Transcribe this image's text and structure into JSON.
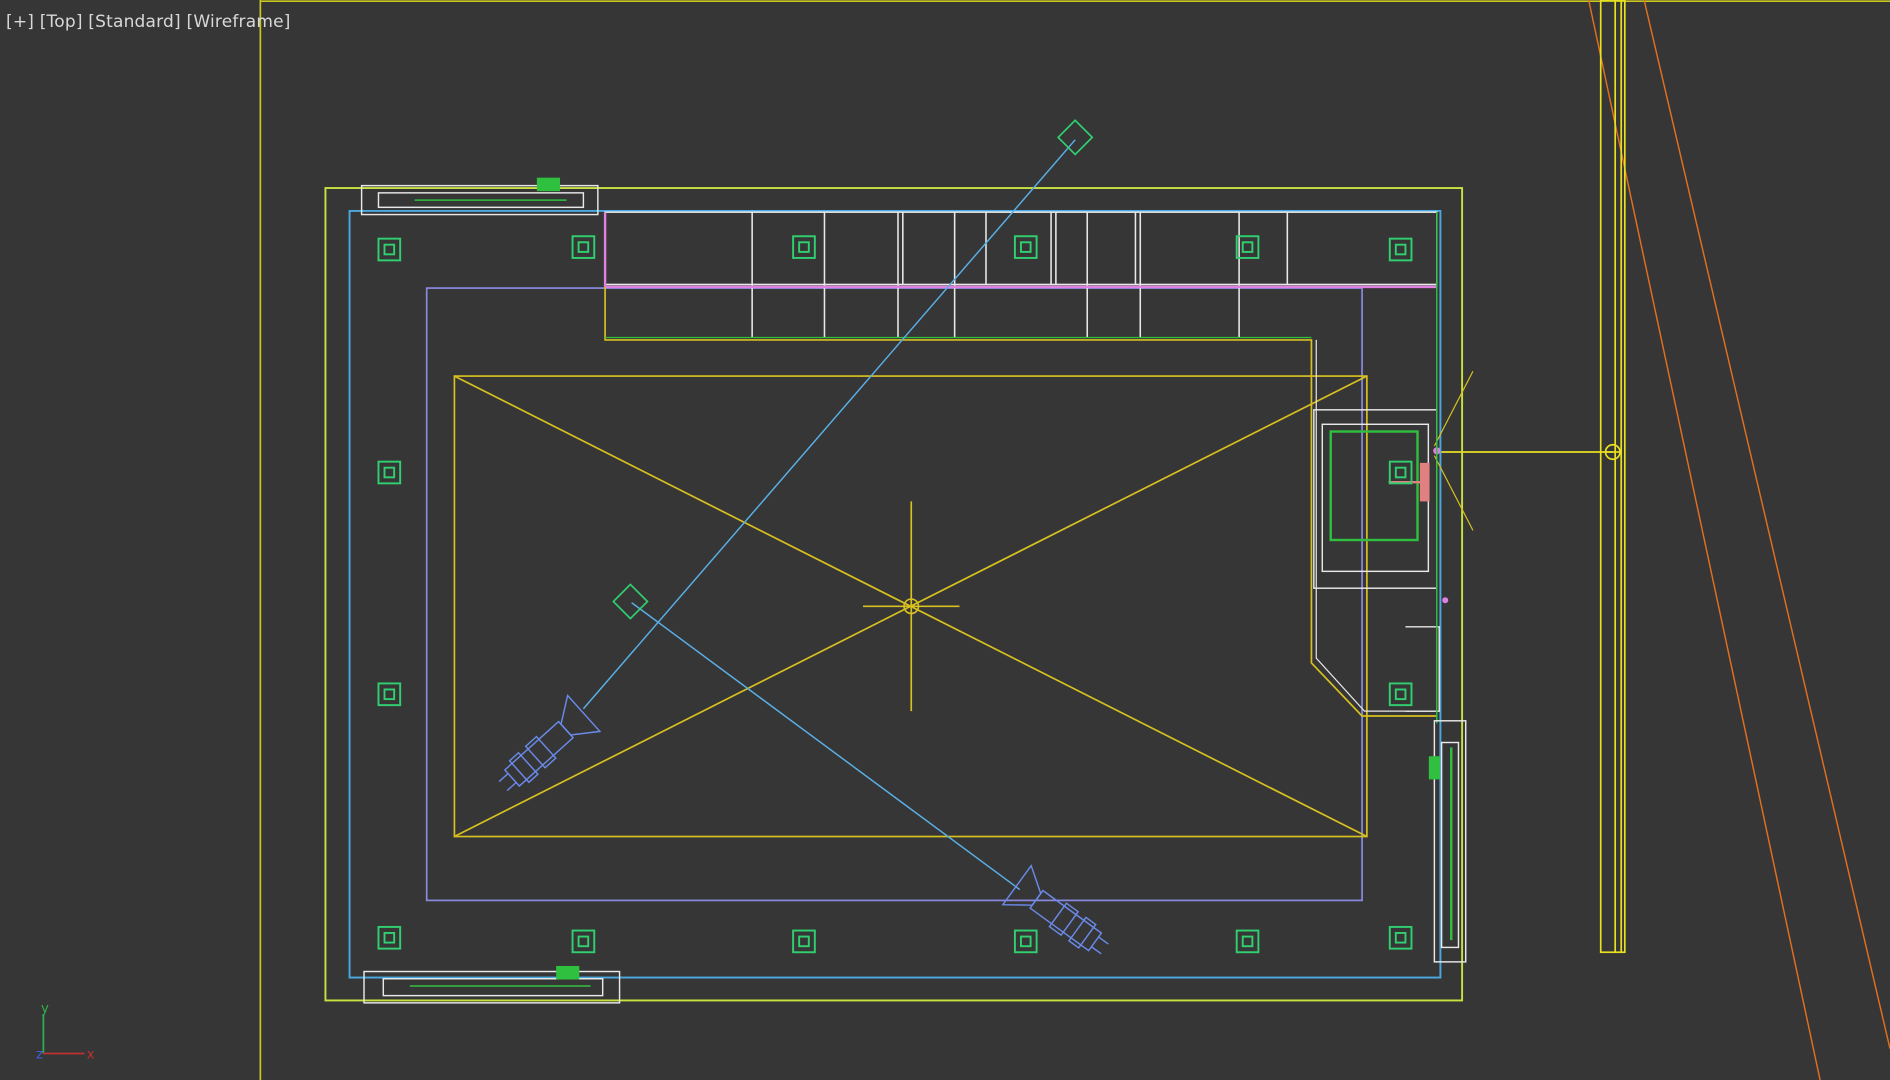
{
  "viewport": {
    "menus": {
      "plus": "[+]",
      "view": "[Top]",
      "shading_preset": "[Standard]",
      "shading_mode": "[Wireframe]"
    },
    "axis": {
      "y": "y",
      "z": "z",
      "x": "x"
    },
    "colors": {
      "background": "#363636",
      "selection_frame": "#c8c820",
      "outer_wall": "#c8e040",
      "inner_wall": "#4aa8e0",
      "ceiling_light": "#d8c020",
      "lavender_frame": "#8a8ae0",
      "spot_lights": "#30d070",
      "camera": "#6a8ae8",
      "camera_target_line": "#5ab0e8",
      "furniture": "#e8e8e8",
      "bathroom_green": "#30c040",
      "orange_guides": "#e07020",
      "pink_accent": "#e080e0"
    }
  }
}
